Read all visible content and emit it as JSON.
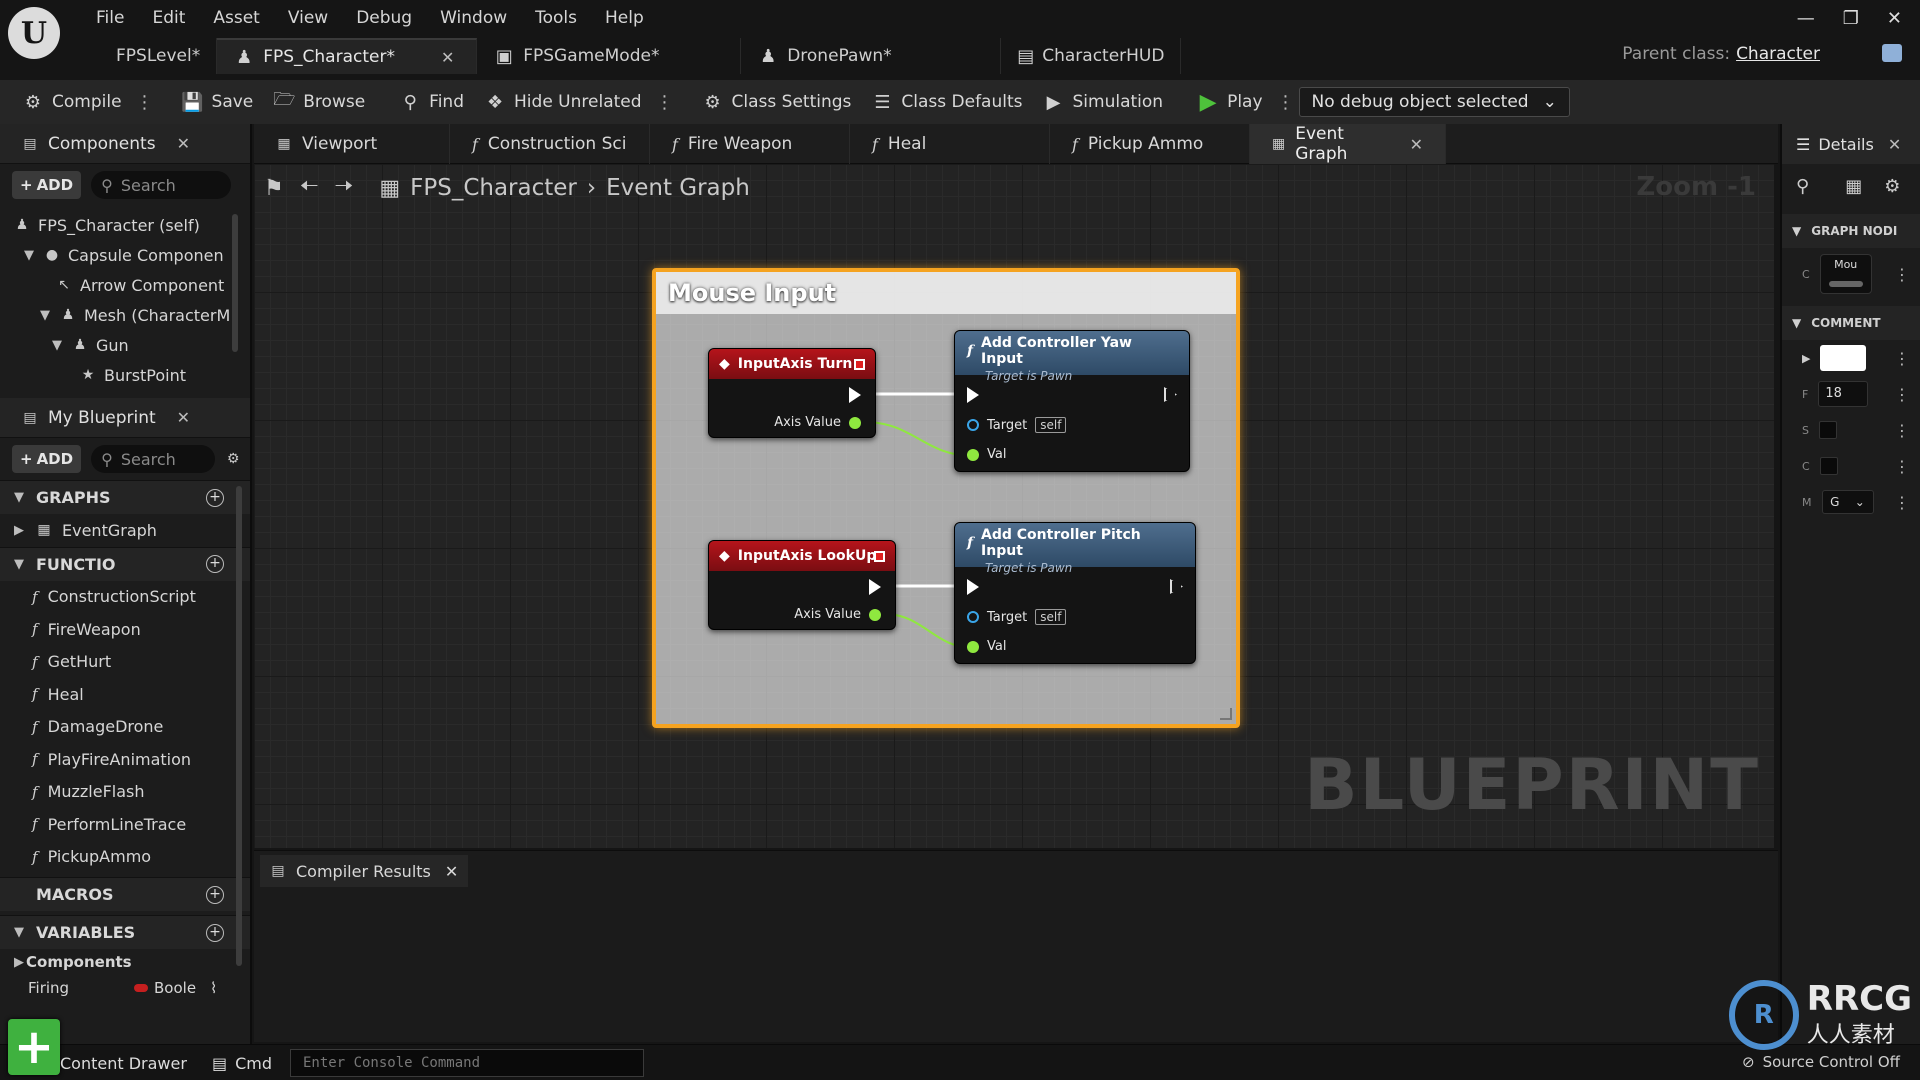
{
  "app": {
    "logo_text": "U",
    "menu": [
      "File",
      "Edit",
      "Asset",
      "View",
      "Debug",
      "Window",
      "Tools",
      "Help"
    ],
    "doc_tabs": [
      {
        "label": "FPSLevel*"
      },
      {
        "label": "FPS_Character*"
      },
      {
        "label": "FPSGameMode*"
      },
      {
        "label": "DronePawn*"
      },
      {
        "label": "CharacterHUD"
      }
    ],
    "parent_class_label": "Parent class:",
    "parent_class_value": "Character"
  },
  "toolbar": {
    "compile": "Compile",
    "save": "Save",
    "browse": "Browse",
    "find": "Find",
    "hide_unrelated": "Hide Unrelated",
    "class_settings": "Class Settings",
    "class_defaults": "Class Defaults",
    "simulation": "Simulation",
    "play": "Play",
    "debug_object": "No debug object selected"
  },
  "components": {
    "tab_label": "Components",
    "add_label": "ADD",
    "search_placeholder": "Search",
    "tree": [
      {
        "label": "FPS_Character (self)"
      },
      {
        "label": "Capsule Componen"
      },
      {
        "label": "Arrow Component"
      },
      {
        "label": "Mesh (CharacterM"
      },
      {
        "label": "Gun"
      },
      {
        "label": "BurstPoint"
      }
    ]
  },
  "my_blueprint": {
    "tab_label": "My Blueprint",
    "add_label": "ADD",
    "search_placeholder": "Search",
    "graphs_label": "GRAPHS",
    "graphs": [
      "EventGraph"
    ],
    "functions_label": "FUNCTIO",
    "functions": [
      "ConstructionScript",
      "FireWeapon",
      "GetHurt",
      "Heal",
      "DamageDrone",
      "PlayFireAnimation",
      "MuzzleFlash",
      "PerformLineTrace",
      "PickupAmmo"
    ],
    "macros_label": "MACROS",
    "variables_label": "VARIABLES",
    "var_category": "Components",
    "variables": [
      {
        "name": "Firing",
        "type": "Boole"
      }
    ]
  },
  "graph_tabs": [
    {
      "label": "Viewport"
    },
    {
      "label": "Construction Sci"
    },
    {
      "label": "Fire Weapon"
    },
    {
      "label": "Heal"
    },
    {
      "label": "Pickup Ammo"
    },
    {
      "label": "Event Graph"
    }
  ],
  "graph": {
    "breadcrumb_root": "FPS_Character",
    "breadcrumb_leaf": "Event Graph",
    "zoom": "Zoom -1",
    "watermark": "BLUEPRINT",
    "comment_title": "Mouse Input",
    "nodes": {
      "turn": {
        "title": "InputAxis Turn",
        "pin": "Axis Value"
      },
      "lookup": {
        "title": "InputAxis LookUp",
        "pin": "Axis Value"
      },
      "yaw": {
        "title": "Add Controller Yaw Input",
        "subtitle": "Target is Pawn",
        "target": "Target",
        "self": "self",
        "val": "Val"
      },
      "pitch": {
        "title": "Add Controller Pitch Input",
        "subtitle": "Target is Pawn",
        "target": "Target",
        "self": "self",
        "val": "Val"
      }
    }
  },
  "bottom": {
    "compiler_tab": "Compiler Results"
  },
  "details": {
    "tab_label": "Details",
    "section_graph_node": "GRAPH NODI",
    "mou_label": "Mou",
    "row_c": "C",
    "section_comment": "COMMENT",
    "row_f": "F",
    "font_size": "18",
    "row_s": "S",
    "row_c2": "C",
    "row_m": "M",
    "mode_value": "G"
  },
  "status": {
    "content_drawer": "Content Drawer",
    "cmd": "Cmd",
    "console_placeholder": "Enter Console Command",
    "source_control": "Source Control Off",
    "corner_logo": "RRCG",
    "corner_logo_sub": "人人素材"
  },
  "colors": {
    "comment_border": "#f5a320",
    "event_header": "#b5141b",
    "function_header": "#4f6e8e",
    "float_pin": "#8fe83f",
    "object_pin": "#3aa5e8",
    "play": "#4ec23b"
  }
}
